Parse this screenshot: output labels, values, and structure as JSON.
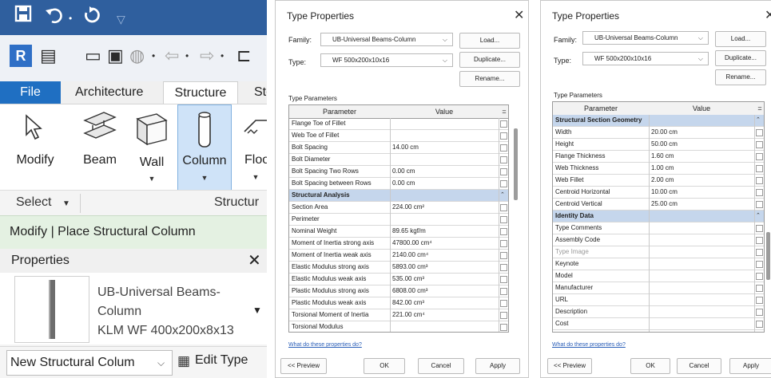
{
  "revit": {
    "ribbon_tabs": [
      "File",
      "Architecture",
      "Structure",
      "Ste"
    ],
    "tools": [
      "Modify",
      "Beam",
      "Wall",
      "Column",
      "Floo"
    ],
    "group_labels": {
      "select": "Select",
      "structure": "Structur"
    },
    "context_bar": "Modify | Place Structural Column",
    "properties": {
      "header": "Properties",
      "family_name_line1": "UB-Universal Beams-",
      "family_name_line2": "Column",
      "type_name": "KLM WF 400x200x8x13"
    },
    "bottom": {
      "combo_text": "New Structural Colum",
      "edit_type": "Edit Type"
    },
    "icons": {
      "save": "save-icon",
      "undo": "undo-icon",
      "sync": "sync-icon",
      "qat_dropdown": "dropdown-icon",
      "logo": "revit-logo",
      "close": "close-icon"
    }
  },
  "dialog_1": {
    "title": "Type Properties",
    "family_label": "Family:",
    "family_value": "UB-Universal Beams-Column",
    "type_label": "Type:",
    "type_value": "WF 500x200x10x16",
    "buttons": {
      "load": "Load...",
      "duplicate": "Duplicate...",
      "rename": "Rename..."
    },
    "type_parameters_label": "Type Parameters",
    "columns": {
      "parameter": "Parameter",
      "value": "Value",
      "toggle": "="
    },
    "rows": [
      {
        "name": "Flange Toe of Fillet",
        "value": ""
      },
      {
        "name": "Web Toe of Fillet",
        "value": ""
      },
      {
        "name": "Bolt Spacing",
        "value": "14.00 cm"
      },
      {
        "name": "Bolt Diameter",
        "value": ""
      },
      {
        "name": "Bolt Spacing Two Rows",
        "value": "0.00 cm"
      },
      {
        "name": "Bolt Spacing between Rows",
        "value": "0.00 cm"
      },
      {
        "name": "Structural Analysis",
        "value": "",
        "group": true
      },
      {
        "name": "Section Area",
        "value": "224.00 cm²"
      },
      {
        "name": "Perimeter",
        "value": ""
      },
      {
        "name": "Nominal Weight",
        "value": "89.65 kgf/m"
      },
      {
        "name": "Moment of Inertia strong axis",
        "value": "47800.00 cm⁴"
      },
      {
        "name": "Moment of Inertia weak axis",
        "value": "2140.00 cm⁴"
      },
      {
        "name": "Elastic Modulus strong axis",
        "value": "5893.00 cm³"
      },
      {
        "name": "Elastic Modulus weak axis",
        "value": "535.00 cm³"
      },
      {
        "name": "Plastic Modulus strong axis",
        "value": "6808.00 cm³"
      },
      {
        "name": "Plastic Modulus weak axis",
        "value": "842.00 cm³"
      },
      {
        "name": "Torsional Moment of Inertia",
        "value": "221.00 cm⁴"
      },
      {
        "name": "Torsional Modulus",
        "value": ""
      }
    ],
    "help_link": "What do these properties do?",
    "footer": {
      "preview": "<< Preview",
      "ok": "OK",
      "cancel": "Cancel",
      "apply": "Apply"
    }
  },
  "dialog_2": {
    "title": "Type Properties",
    "family_label": "Family:",
    "family_value": "UB-Universal Beams-Column",
    "type_label": "Type:",
    "type_value": "WF 500x200x10x16",
    "buttons": {
      "load": "Load...",
      "duplicate": "Duplicate...",
      "rename": "Rename..."
    },
    "type_parameters_label": "Type Parameters",
    "columns": {
      "parameter": "Parameter",
      "value": "Value",
      "toggle": "="
    },
    "rows": [
      {
        "name": "Structural Section Geometry",
        "value": "",
        "group": true
      },
      {
        "name": "Width",
        "value": "20.00 cm"
      },
      {
        "name": "Height",
        "value": "50.00 cm"
      },
      {
        "name": "Flange Thickness",
        "value": "1.60 cm"
      },
      {
        "name": "Web Thickness",
        "value": "1.00 cm"
      },
      {
        "name": "Web Fillet",
        "value": "2.00 cm"
      },
      {
        "name": "Centroid Horizontal",
        "value": "10.00 cm"
      },
      {
        "name": "Centroid Vertical",
        "value": "25.00 cm"
      },
      {
        "name": "Identity Data",
        "value": "",
        "group": true
      },
      {
        "name": "Type Comments",
        "value": ""
      },
      {
        "name": "Assembly Code",
        "value": ""
      },
      {
        "name": "Type Image",
        "value": "",
        "muted": true
      },
      {
        "name": "Keynote",
        "value": ""
      },
      {
        "name": "Model",
        "value": ""
      },
      {
        "name": "Manufacturer",
        "value": ""
      },
      {
        "name": "URL",
        "value": ""
      },
      {
        "name": "Description",
        "value": ""
      },
      {
        "name": "Cost",
        "value": ""
      }
    ],
    "help_link": "What do these properties do?",
    "footer": {
      "preview": "<< Preview",
      "ok": "OK",
      "cancel": "Cancel",
      "apply": "Apply"
    }
  }
}
